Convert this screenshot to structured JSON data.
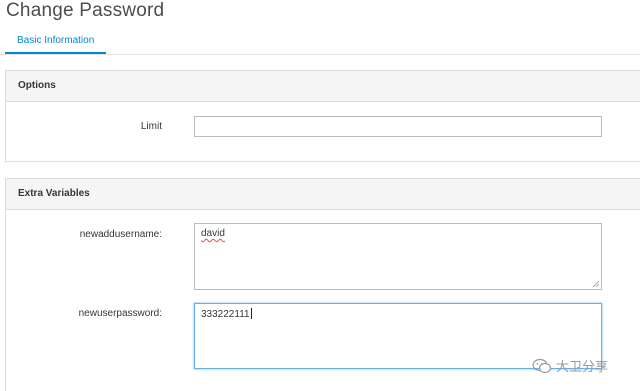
{
  "page": {
    "title": "Change Password"
  },
  "tabs": [
    {
      "label": "Basic Information",
      "active": true
    }
  ],
  "options_panel": {
    "header": "Options",
    "fields": [
      {
        "label": "Limit",
        "value": ""
      }
    ]
  },
  "extra_vars_panel": {
    "header": "Extra Variables",
    "fields": [
      {
        "label": "newaddusername:",
        "value": "david"
      },
      {
        "label": "newuserpassword:",
        "value": "333222111"
      }
    ]
  },
  "watermark": {
    "text": "大卫分享",
    "icon": "wechat-bubble-icon"
  },
  "colors": {
    "accent": "#0088ce",
    "panel_header_bg": "#f5f5f5",
    "focus_border": "#66afe9"
  }
}
